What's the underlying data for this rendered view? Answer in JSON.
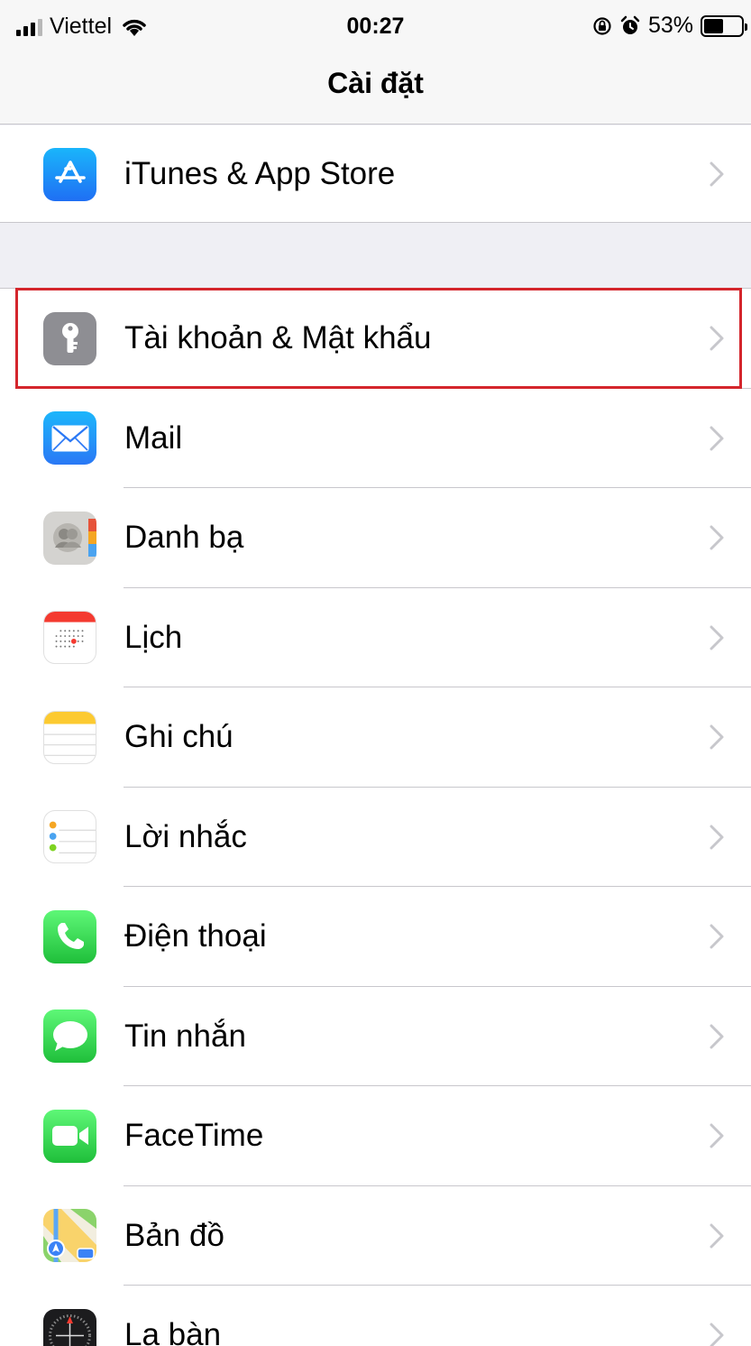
{
  "status_bar": {
    "carrier": "Viettel",
    "time": "00:27",
    "battery_percent": "53%",
    "battery_level": 0.53
  },
  "nav": {
    "title": "Cài đặt"
  },
  "groups": [
    {
      "items": [
        {
          "label": "iTunes & App Store",
          "icon": "app-store-icon"
        }
      ]
    },
    {
      "items": [
        {
          "label": "Tài khoản & Mật khẩu",
          "icon": "key-icon",
          "highlighted": true
        },
        {
          "label": "Mail",
          "icon": "mail-icon"
        },
        {
          "label": "Danh bạ",
          "icon": "contacts-icon"
        },
        {
          "label": "Lịch",
          "icon": "calendar-icon"
        },
        {
          "label": "Ghi chú",
          "icon": "notes-icon"
        },
        {
          "label": "Lời nhắc",
          "icon": "reminders-icon"
        },
        {
          "label": "Điện thoại",
          "icon": "phone-icon"
        },
        {
          "label": "Tin nhắn",
          "icon": "messages-icon"
        },
        {
          "label": "FaceTime",
          "icon": "facetime-icon"
        },
        {
          "label": "Bản đồ",
          "icon": "maps-icon"
        },
        {
          "label": "La bàn",
          "icon": "compass-icon"
        }
      ]
    }
  ],
  "colors": {
    "highlight_border": "#d4262c",
    "app_store": "#1e8ff5",
    "key": "#8e8e93",
    "mail": "#2f8cf6",
    "phone": "#34c759",
    "messages": "#34c759",
    "facetime": "#34c759"
  }
}
